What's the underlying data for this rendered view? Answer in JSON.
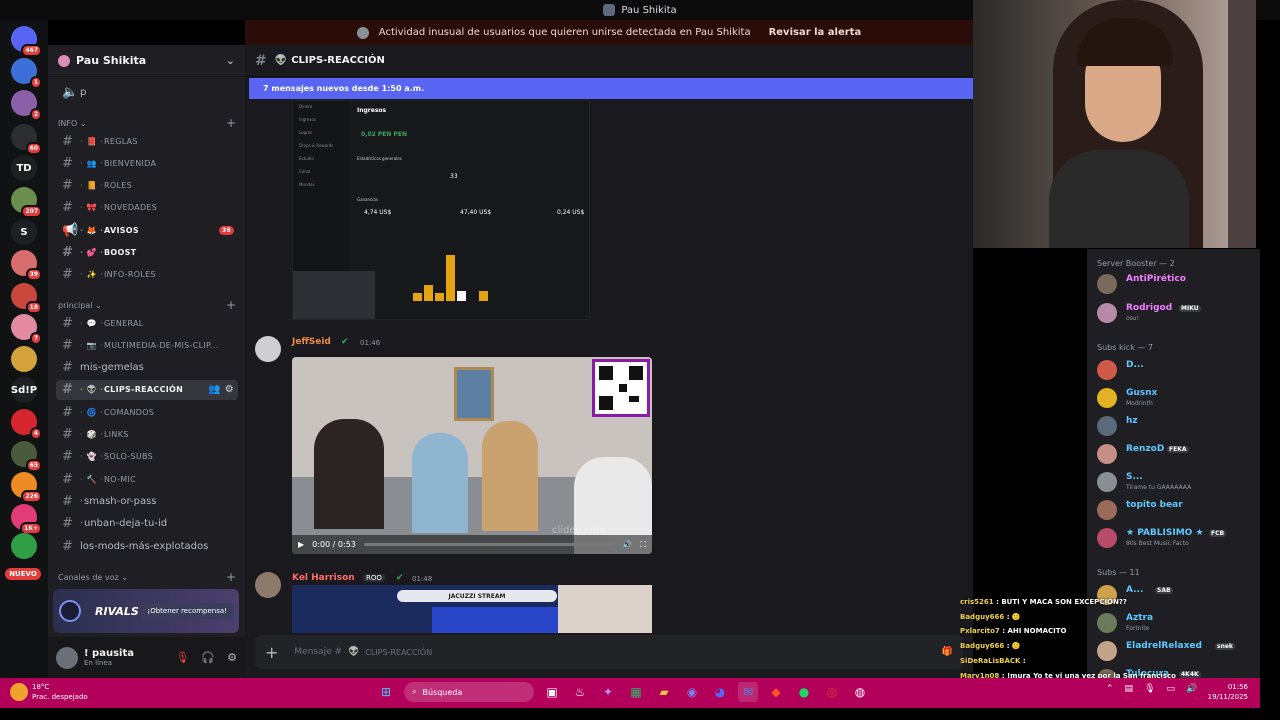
{
  "window": {
    "title": "Pau Shikita"
  },
  "alert": {
    "text": "Actividad inusual de usuarios que quieren unirse detectada en Pau Shikita",
    "action": "Revisar la alerta"
  },
  "guilds": {
    "items": [
      {
        "label": "",
        "badge": "467",
        "color": "#5865f2"
      },
      {
        "label": "",
        "badge": "1",
        "color": "#3d6fd9"
      },
      {
        "label": "",
        "badge": "2",
        "color": "#8a5fa8"
      },
      {
        "label": "",
        "badge": "60",
        "color": "#2b2d31"
      },
      {
        "label": "TD",
        "badge": "",
        "color": "#1e1f22"
      },
      {
        "label": "",
        "badge": "207",
        "color": "#6b8e4e"
      },
      {
        "label": "S",
        "badge": "",
        "color": "#1e1f22"
      },
      {
        "label": "",
        "badge": "39",
        "color": "#d86d6d"
      },
      {
        "label": "",
        "badge": "18",
        "color": "#c9473b"
      },
      {
        "label": "",
        "badge": "7",
        "color": "#e28aa2"
      },
      {
        "label": "",
        "badge": "",
        "color": "#d4a23a"
      },
      {
        "label": "Sd!P",
        "badge": "",
        "color": "#1e1f22"
      },
      {
        "label": "",
        "badge": "4",
        "color": "#d6252e"
      },
      {
        "label": "",
        "badge": "65",
        "color": "#4b5a3c"
      },
      {
        "label": "",
        "badge": "226",
        "color": "#f08a24"
      },
      {
        "label": "",
        "badge": "1K+",
        "color": "#e13c75"
      },
      {
        "label": "",
        "badge": "",
        "color": "#2f9e44"
      }
    ],
    "new_label": "NUEVO"
  },
  "server": {
    "name": "Pau Shikita"
  },
  "channels": {
    "voice_top": "p",
    "cat_info": "INFO",
    "info": [
      {
        "name": "REGLAS",
        "emoji": "📕",
        "bold": false
      },
      {
        "name": "BIENVENIDA",
        "emoji": "👥",
        "bold": false
      },
      {
        "name": "ROLES",
        "emoji": "📙",
        "bold": false
      },
      {
        "name": "NOVEDADES",
        "emoji": "🎀",
        "bold": false
      },
      {
        "name": "AVISOS",
        "emoji": "🦊",
        "bold": true,
        "count": "36"
      },
      {
        "name": "BOOST",
        "emoji": "💕",
        "bold": true
      },
      {
        "name": "INFO-ROLES",
        "emoji": "✨",
        "bold": false
      }
    ],
    "cat_principal": "principal",
    "principal": [
      {
        "name": "GENERAL",
        "emoji": "💬"
      },
      {
        "name": "MULTIMEDIA-DE-MIS-CLIP...",
        "emoji": "📷"
      },
      {
        "name": "mis-gemelas",
        "emoji": ""
      },
      {
        "name": "CLIPS-REACCIÓN",
        "emoji": "👽",
        "active": true
      },
      {
        "name": "COMANDOS",
        "emoji": "🌀"
      },
      {
        "name": "LINKS",
        "emoji": "🎲"
      },
      {
        "name": "SOLO-SUBS",
        "emoji": "👻"
      },
      {
        "name": "NO-MIC",
        "emoji": "🔨"
      },
      {
        "name": "smash-or-pass",
        "emoji": ""
      },
      {
        "name": "unban-deja-tu-id",
        "emoji": ""
      },
      {
        "name": "los-mods-más-explotados",
        "emoji": ""
      }
    ],
    "cat_voice": "Canales de voz"
  },
  "promo": {
    "logo": "RIVALS",
    "button": "¡Obtener recompensa!"
  },
  "user": {
    "name": "! pausita",
    "status": "En línea"
  },
  "channel_header": {
    "name": "CLIPS-REACCIÓN"
  },
  "new_messages": "7 mensajes nuevos desde 1:50 a.m.",
  "screenshot_embed": {
    "title": "Ingresos",
    "amount": "0,02 PEN PEN",
    "stats_title": "Estadísticas generales",
    "stat_value": "33",
    "earnings_title": "Ganancias",
    "values": [
      "4,74 US$",
      "47,40 US$",
      "0,24 US$"
    ],
    "sidebar": [
      "Dinero",
      "Ingresos",
      "Logros",
      "Drops & Rewards",
      "Estudio",
      "Canal",
      "Mundos"
    ]
  },
  "messages": [
    {
      "author": "JeffSeid",
      "time": "01:46"
    },
    {
      "author": "Kel Harrison",
      "tag": "ROO",
      "time": "01:48"
    }
  ],
  "video": {
    "time": "0:00 / 0:53",
    "watermark": "clideo.com"
  },
  "jacuzzi": "JACUZZI STREAM",
  "composer": {
    "placeholder": "Mensaje #",
    "channel": "CLIPS-REACCIÓN"
  },
  "members": {
    "sec_booster": "Server Booster — 2",
    "boosters": [
      {
        "name": "AntiPirético",
        "color": "#f47fff",
        "sub": ""
      },
      {
        "name": "Rodrigod",
        "color": "#f47fff",
        "tag": "MIKU",
        "sub": "osu!"
      }
    ],
    "sec_kick": "Subs kick — 7",
    "kick": [
      {
        "name": "D...",
        "color": "#5ec8ff",
        "sub": ""
      },
      {
        "name": "Gusnx",
        "color": "#5ec8ff",
        "sub": "Modrinth"
      },
      {
        "name": "hz",
        "color": "#5ec8ff",
        "sub": ""
      },
      {
        "name": "RenzoD",
        "color": "#5ec8ff",
        "tag": "FEKA",
        "sub": ""
      },
      {
        "name": "S...",
        "color": "#5ec8ff",
        "sub": "Tirame tu GAAAAAAA"
      },
      {
        "name": "topito bear",
        "color": "#5ec8ff",
        "sub": ""
      },
      {
        "name": "★ PABLISIMO ★",
        "color": "#5ec8ff",
        "tag": "FCB",
        "sub": "80s Best Music Facto"
      }
    ],
    "sec_subs": "Subs — 11",
    "subs": [
      {
        "name": "A...",
        "color": "#5ec8ff",
        "tag": "SAB",
        "sub": ""
      },
      {
        "name": "Aztra",
        "color": "#5ec8ff",
        "sub": "Fortnite"
      },
      {
        "name": "EladrelRelaxed",
        "color": "#5ec8ff",
        "tag": "snek",
        "sub": ""
      },
      {
        "name": "Tulocura",
        "color": "#5ec8ff",
        "tag": "4K4K",
        "sub": ""
      }
    ]
  },
  "stream_chat": [
    {
      "user": "cris5261",
      "text": ": BUTI Y MACA SON EXCEPCIÓN??"
    },
    {
      "user": "Badguy666",
      "text": ": 🙂"
    },
    {
      "user": "Pxlarcito7",
      "text": ": AHI NOMACITO"
    },
    {
      "user": "Badguy666",
      "text": ": 🙂"
    },
    {
      "user": "SiDeRaLisBACK",
      "text": ":"
    },
    {
      "user": "Marv1n08",
      "text": ": !mura Yo te vi una vez por la San francisco"
    }
  ],
  "taskbar": {
    "temp": "18°C",
    "weather": "Prac. despejado",
    "search": "Búsqueda",
    "time": "01:56",
    "date": "19/11/2025"
  }
}
